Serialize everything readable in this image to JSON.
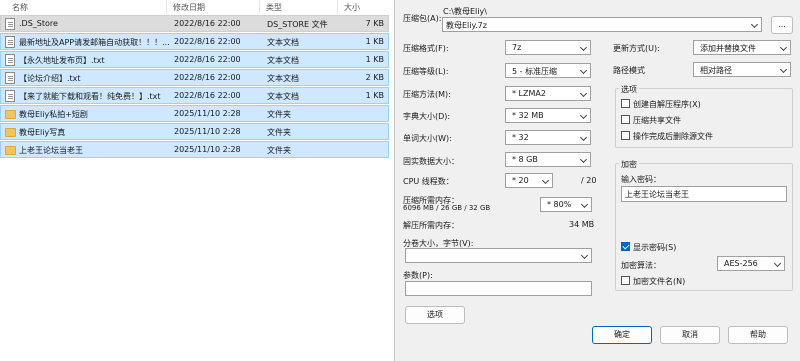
{
  "filelist": {
    "columns": {
      "name": "名称",
      "date": "修改日期",
      "type": "类型",
      "size": "大小"
    },
    "rows": [
      {
        "name": ".DS_Store",
        "date": "2022/8/16 22:00",
        "type": "DS_STORE 文件",
        "size": "7 KB",
        "icon": "file-icon"
      },
      {
        "name": "最新地址及APP请发邮箱自动获取！！！...",
        "date": "2022/8/16 22:00",
        "type": "文本文档",
        "size": "1 KB",
        "icon": "file-icon"
      },
      {
        "name": "【永久地址发布页】.txt",
        "date": "2022/8/16 22:00",
        "type": "文本文档",
        "size": "1 KB",
        "icon": "file-icon"
      },
      {
        "name": "【论坛介绍】.txt",
        "date": "2022/8/16 22:00",
        "type": "文本文档",
        "size": "2 KB",
        "icon": "file-icon"
      },
      {
        "name": "【来了就能下载和观看！纯免费！】.txt",
        "date": "2022/8/16 22:00",
        "type": "文本文档",
        "size": "1 KB",
        "icon": "file-icon"
      },
      {
        "name": "教母Eliy私拍+短剧",
        "date": "2025/11/10 2:28",
        "type": "文件夹",
        "size": "",
        "icon": "folder-icon"
      },
      {
        "name": "教母Eliy写真",
        "date": "2025/11/10 2:28",
        "type": "文件夹",
        "size": "",
        "icon": "folder-icon"
      },
      {
        "name": "上老王论坛当老王",
        "date": "2025/11/10 2:28",
        "type": "文件夹",
        "size": "",
        "icon": "folder-icon"
      }
    ]
  },
  "dialog": {
    "archive_label": "压缩包(A):",
    "archive_path": "C:\\教母Eliy\\",
    "archive_name": "教母Eliy.7z",
    "browse_label": "...",
    "format_label": "压缩格式(F):",
    "format_value": "7z",
    "level_label": "压缩等级(L):",
    "level_value": "5 - 标准压缩",
    "method_label": "压缩方法(M):",
    "method_value": "* LZMA2",
    "dict_label": "字典大小(D):",
    "dict_value": "* 32 MB",
    "word_label": "单词大小(W):",
    "word_value": "* 32",
    "solid_label": "固实数据大小：",
    "solid_value": "* 8 GB",
    "cpu_label": "CPU 线程数：",
    "cpu_value": "* 20",
    "cpu_total": "/ 20",
    "mem_label": "压缩所需内存：",
    "mem_detail": "6096 MB / 26 GB / 32 GB",
    "mem_percent": "* 80%",
    "decomp_label": "解压所需内存：",
    "decomp_value": "34 MB",
    "split_label": "分卷大小，字节(V):",
    "params_label": "参数(P):",
    "options_button": "选项",
    "update_label": "更新方式(U):",
    "update_value": "添加并替换文件",
    "pathmode_label": "路径模式",
    "pathmode_value": "相对路径",
    "options_group": "选项",
    "opt_sfx": "创建自解压程序(X)",
    "opt_shared": "压缩共享文件",
    "opt_delete": "操作完成后删除源文件",
    "encrypt_group": "加密",
    "password_label": "输入密码：",
    "password_value": "上老王论坛当老王",
    "show_password": "显示密码(S)",
    "enc_method_label": "加密算法：",
    "enc_method_value": "AES-256",
    "enc_names": "加密文件名(N)",
    "ok": "确定",
    "cancel": "取消",
    "help": "帮助"
  }
}
